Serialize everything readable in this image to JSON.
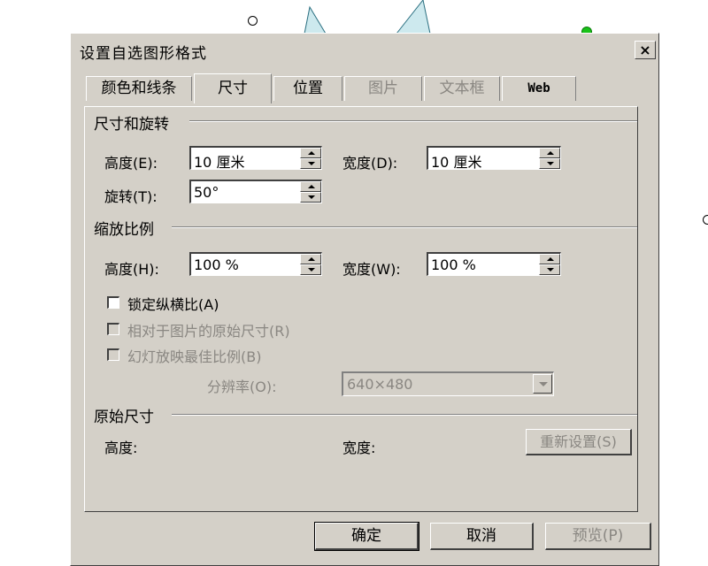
{
  "dialog": {
    "title": "设置自选图形格式",
    "close_label": "×"
  },
  "tabs": [
    {
      "label": "颜色和线条",
      "state": "normal"
    },
    {
      "label": "尺寸",
      "state": "active"
    },
    {
      "label": "位置",
      "state": "normal"
    },
    {
      "label": "图片",
      "state": "disabled"
    },
    {
      "label": "文本框",
      "state": "disabled"
    },
    {
      "label": "Web",
      "state": "normal"
    }
  ],
  "size_rotate": {
    "section": "尺寸和旋转",
    "height_label": "高度(E):",
    "height_value": "10 厘米",
    "width_label": "宽度(D):",
    "width_value": "10 厘米",
    "rotate_label": "旋转(T):",
    "rotate_value": "50°"
  },
  "scale": {
    "section": "缩放比例",
    "height_label": "高度(H):",
    "height_value": "100 %",
    "width_label": "宽度(W):",
    "width_value": "100 %",
    "lock_label": "锁定纵横比(A)",
    "relative_label": "相对于图片的原始尺寸(R)",
    "slideshow_label": "幻灯放映最佳比例(B)",
    "resolution_label": "分辨率(O):",
    "resolution_value": "640×480"
  },
  "original": {
    "section": "原始尺寸",
    "height_label": "高度:",
    "width_label": "宽度:",
    "reset_label": "重新设置(S)"
  },
  "buttons": {
    "ok": "确定",
    "cancel": "取消",
    "preview": "预览(P)"
  },
  "colors": {
    "dialog_face": "#d4d0c8",
    "shape_fill": "#cde9ee",
    "handle_green": "#19c219"
  }
}
